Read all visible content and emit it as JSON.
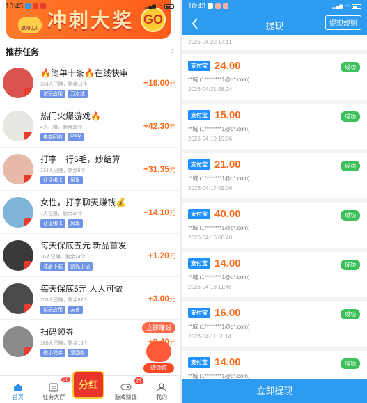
{
  "left": {
    "status": {
      "time": "10:43"
    },
    "banner": {
      "coin_label": "2000人",
      "text": "冲刺大奖",
      "go": "GO"
    },
    "section_title": "推荐任务",
    "tasks": [
      {
        "title": "🔥简单十条🔥在线快审",
        "sub": "334人已赚，剩余11个",
        "tags": [
          "试玩应用",
          "万京达"
        ],
        "reward": "+18.00",
        "unit": "元",
        "color": "#d9534f"
      },
      {
        "title": "热门火爆游戏🔥",
        "sub": "4人已赚，剩余16个",
        "tags": [
          "电商回收",
          "Daily"
        ],
        "reward": "+42.30",
        "unit": "元",
        "color": "#e8e6e0"
      },
      {
        "title": "打字一行5毛，妙结算",
        "sub": "134人已赚，剩余6个",
        "tags": [
          "认证绑卡",
          "凤发"
        ],
        "reward": "+31.35",
        "unit": "元",
        "color": "#e7b9a8"
      },
      {
        "title": "女性，打字聊天赚钱💰",
        "sub": "7人已赚，剩余10个",
        "tags": [
          "认证绑卡",
          "凤发"
        ],
        "reward": "+14.10",
        "unit": "元",
        "color": "#7fb5d9"
      },
      {
        "title": "每天保底五元 新品首发",
        "sub": "16人已赚，剩余14个",
        "tags": [
          "注册下载",
          "凯光小记"
        ],
        "reward": "+1.20",
        "unit": "元",
        "color": "#3a3a3a"
      },
      {
        "title": "每天保底5元 人人可做",
        "sub": "253人已赚，剩余87个",
        "tags": [
          "试玩应用",
          "友善"
        ],
        "reward": "+3.00",
        "unit": "元",
        "color": "#4a4a4a"
      },
      {
        "title": "扫码领券",
        "sub": "185人已赚，剩余15个",
        "tags": [
          "微小程序",
          "爱回收"
        ],
        "reward": "+0.40",
        "unit": "元",
        "color": "#8a8a8a"
      }
    ],
    "float": {
      "earn": "立即赚钱",
      "claim": "请领取"
    },
    "tabs": {
      "home": "首页",
      "hall": "任务大厅",
      "hall_badge": "38",
      "center": "分红",
      "games": "游戏赚钱",
      "games_badge": "新",
      "mine": "我的"
    }
  },
  "right": {
    "status": {
      "time": "10:43"
    },
    "header": {
      "title": "提现",
      "rule_button": "提现规则"
    },
    "top_date": "2026-04-22 17:11",
    "records": [
      {
        "method": "支付宝",
        "amount": "24.00",
        "status": "成功",
        "account": "**城 (1********1@q*.com)",
        "date": "2026-04-21 08:24"
      },
      {
        "method": "支付宝",
        "amount": "15.00",
        "status": "成功",
        "account": "**城 (1********1@q*.com)",
        "date": "2026-04-19 19:06"
      },
      {
        "method": "支付宝",
        "amount": "21.00",
        "status": "成功",
        "account": "**城 (1********1@q*.com)",
        "date": "2026-04-17 09:06"
      },
      {
        "method": "支付宝",
        "amount": "40.00",
        "status": "成功",
        "account": "**城 (1********1@q*.com)",
        "date": "2026-04-16 06:40"
      },
      {
        "method": "支付宝",
        "amount": "14.00",
        "status": "成功",
        "account": "**城 (1********1@q*.com)",
        "date": "2026-04-13 11:46"
      },
      {
        "method": "支付宝",
        "amount": "16.00",
        "status": "成功",
        "account": "**城 (1********1@q*.com)",
        "date": "2026-04-11 11:14"
      },
      {
        "method": "支付宝",
        "amount": "14.00",
        "status": "成功",
        "account": "**城 (1********1@q*.com)",
        "date": ""
      }
    ],
    "withdraw_button": "立即提现"
  }
}
